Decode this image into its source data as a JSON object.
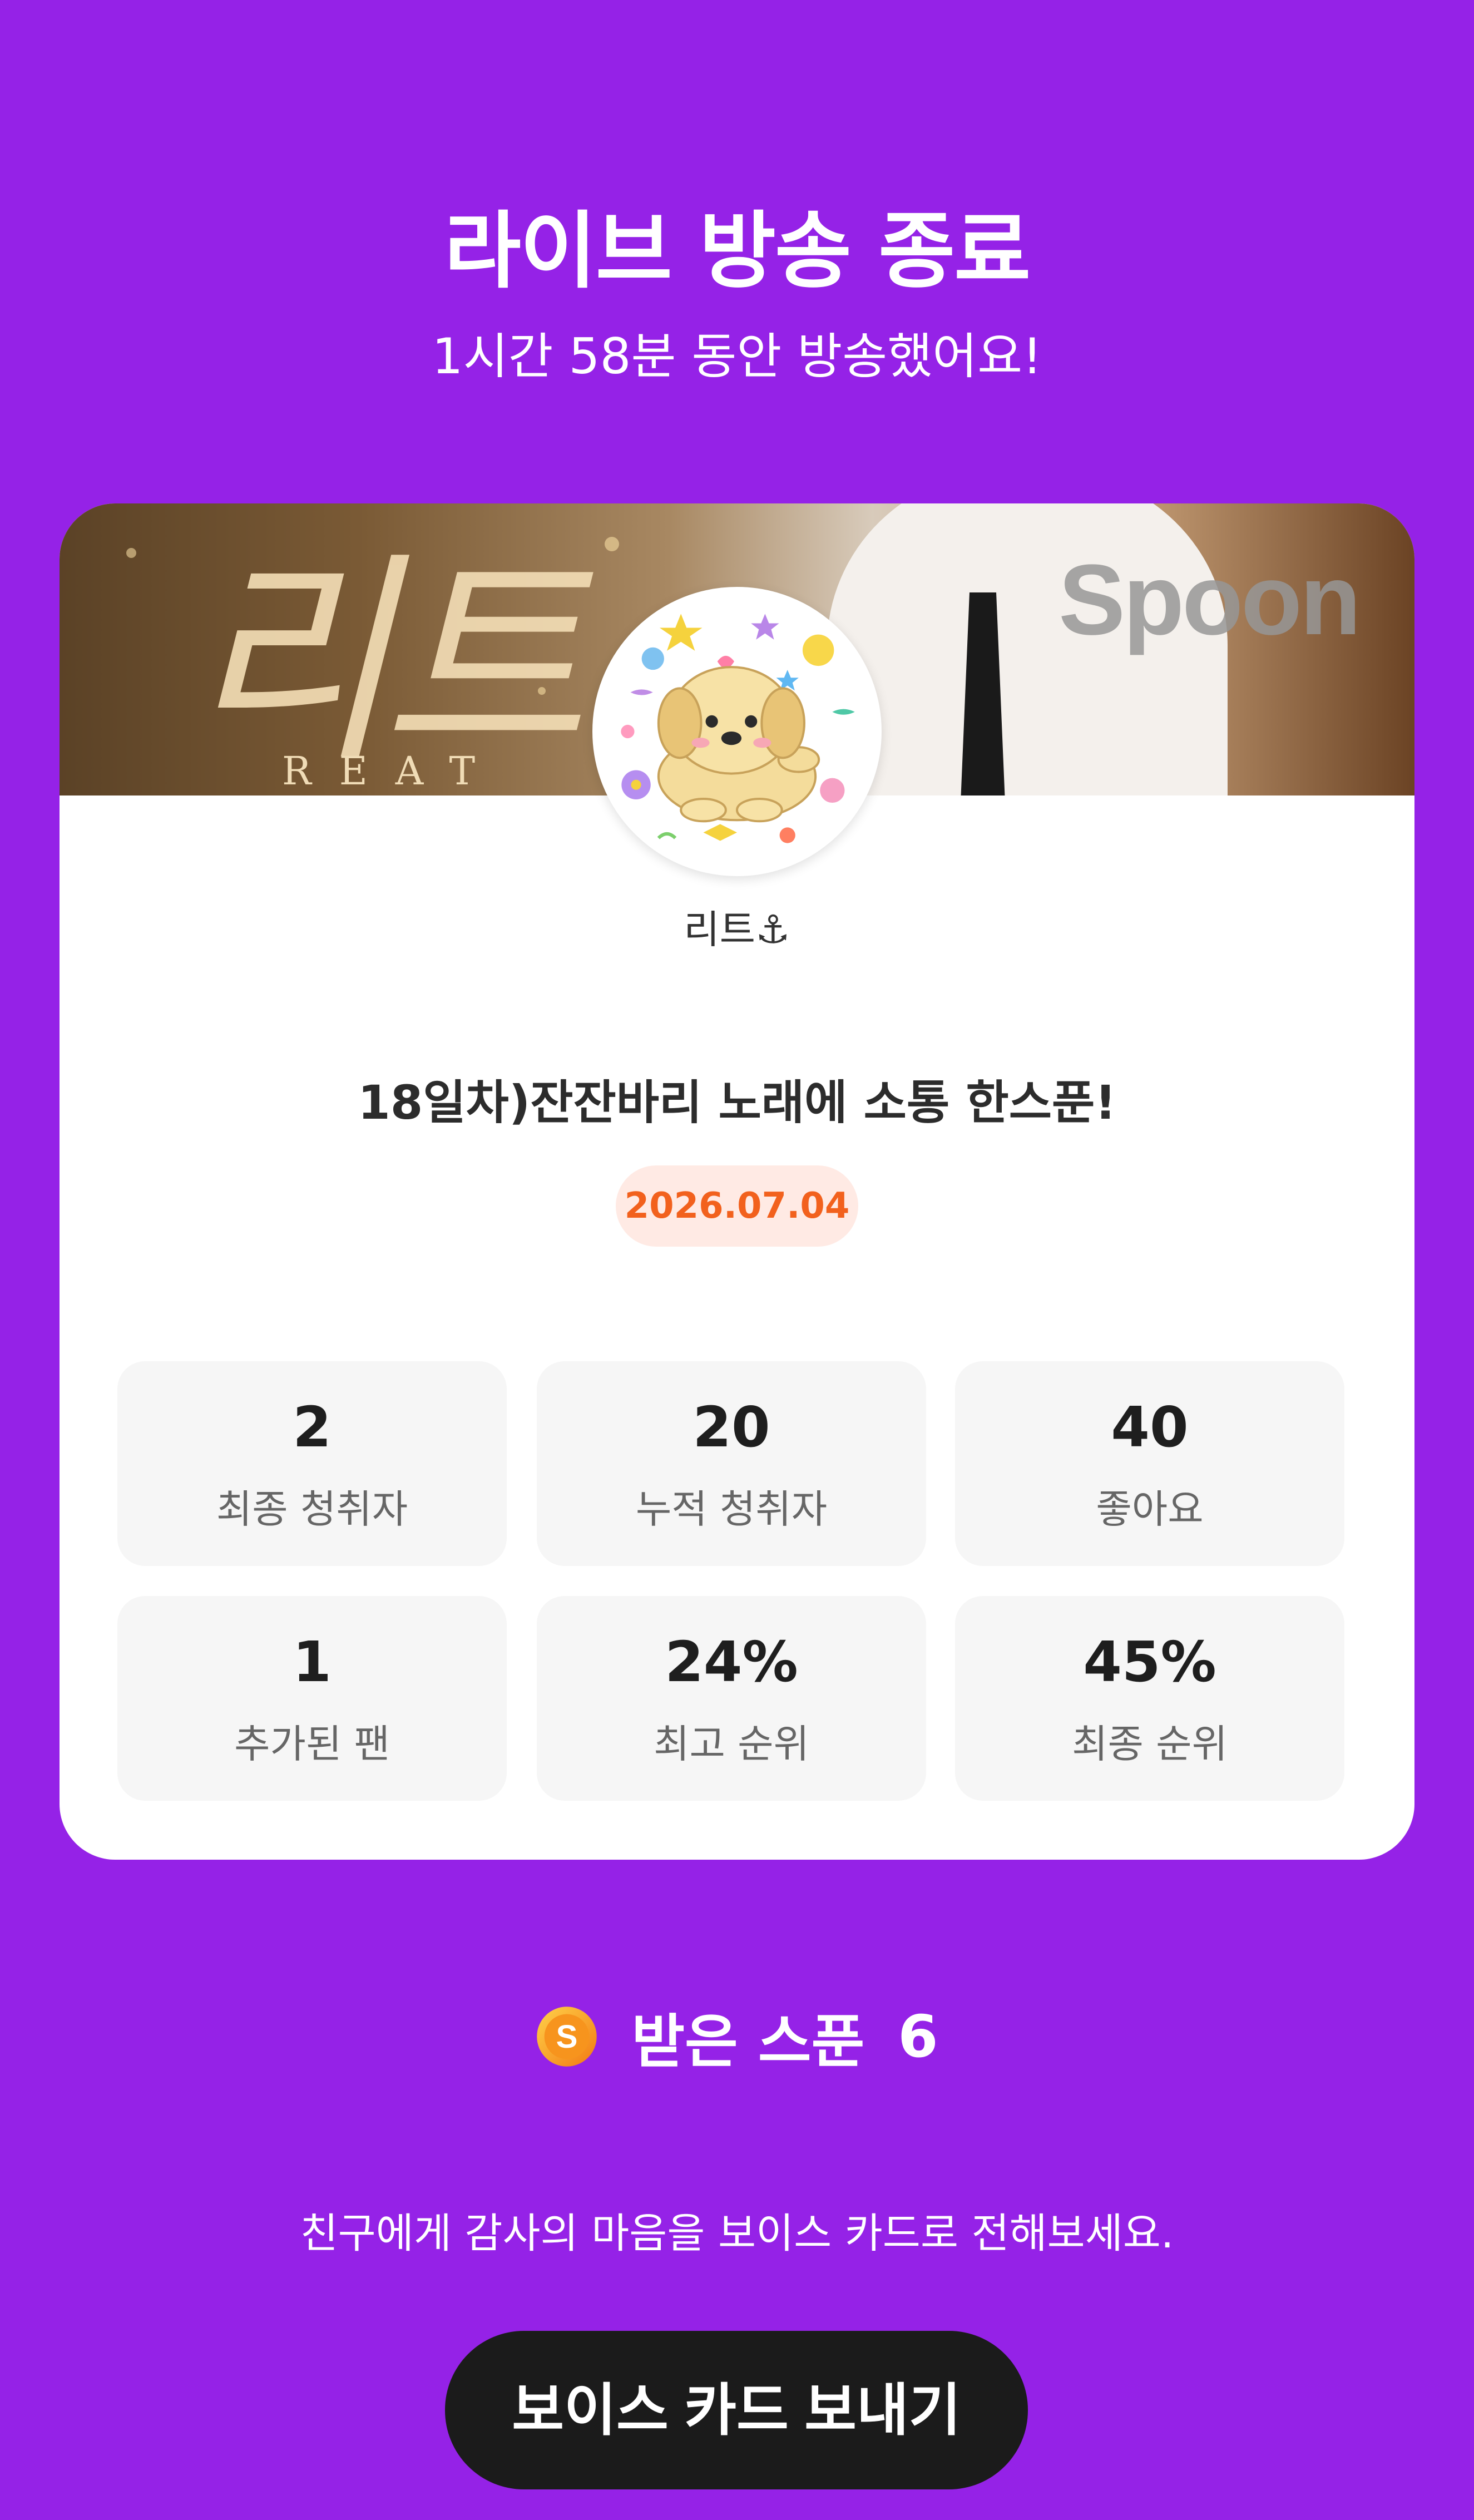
{
  "header": {
    "title": "라이브 방송 종료",
    "subtitle": "1시간 58분 동안 방송했어요!"
  },
  "card": {
    "banner": {
      "script_text": "리트",
      "sub_text": "REAT",
      "watermark": "Spoon"
    },
    "dj_name": "리트⚓",
    "broadcast_title": "18일차)잔잔바리 노래에 소통 한스푼!",
    "date": "2026.07.04",
    "stats": [
      {
        "value": "2",
        "label": "최종 청취자"
      },
      {
        "value": "20",
        "label": "누적 청취자"
      },
      {
        "value": "40",
        "label": "좋아요"
      },
      {
        "value": "1",
        "label": "추가된 팬"
      },
      {
        "value": "24%",
        "label": "최고 순위"
      },
      {
        "value": "45%",
        "label": "최종 순위"
      }
    ]
  },
  "spoons": {
    "icon": "spoon-coin-icon",
    "label": "받은 스푼",
    "count": "6"
  },
  "voice_card": {
    "prompt": "친구에게 감사의 마음을 보이스 카드로 전해보세요.",
    "button_label": "보이스 카드 보내기"
  },
  "colors": {
    "background": "#9522e7",
    "card": "#ffffff",
    "stat_box": "#f6f6f6",
    "date_badge_bg": "#ffeae4",
    "date_badge_text": "#f2611d",
    "button": "#1b1b1b",
    "coin": "#f7a21d"
  }
}
